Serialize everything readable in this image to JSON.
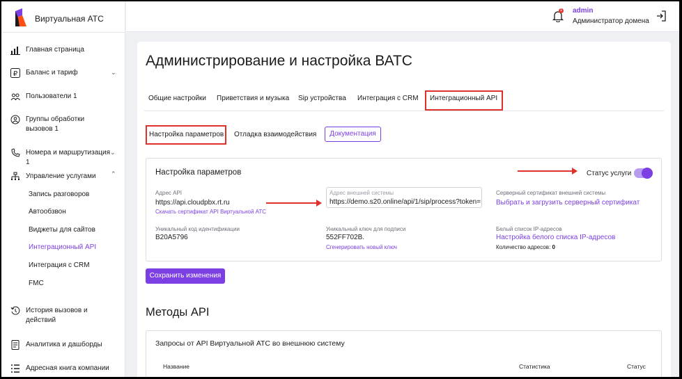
{
  "brand": {
    "name": "Виртуальная АТС"
  },
  "sidebar": {
    "items": [
      {
        "label": "Главная страница",
        "icon": "bar-chart-icon"
      },
      {
        "label": "Баланс и тариф",
        "icon": "ruble-icon"
      },
      {
        "label": "Пользователи 1",
        "icon": "users-icon"
      },
      {
        "label": "Группы обработки вызовов 1",
        "icon": "group-icon"
      },
      {
        "label": "Номера и маршрутизация 1",
        "icon": "phone-routing-icon"
      },
      {
        "label": "Управление услугами",
        "icon": "services-icon"
      },
      {
        "label": "История вызовов и действий",
        "icon": "history-icon"
      },
      {
        "label": "Аналитика и дашборды",
        "icon": "analytics-icon"
      },
      {
        "label": "Адресная книга компании",
        "icon": "address-book-icon"
      }
    ],
    "sub_items": [
      {
        "label": "Запись разговоров"
      },
      {
        "label": "Автообзвон"
      },
      {
        "label": "Виджеты для сайтов"
      },
      {
        "label": "Интеграционный API"
      },
      {
        "label": "Интеграция с CRM"
      },
      {
        "label": "FMC"
      }
    ]
  },
  "header": {
    "user_name": "admin",
    "user_role": "Администратор домена",
    "notification_count": "1"
  },
  "page": {
    "title": "Администрирование и настройка ВАТС",
    "tabs": [
      {
        "label": "Общие настройки"
      },
      {
        "label": "Приветствия и музыка"
      },
      {
        "label": "Sip устройства"
      },
      {
        "label": "Интеграция с CRM"
      },
      {
        "label": "Интеграционный API"
      }
    ],
    "subtabs": [
      {
        "label": "Настройка параметров"
      },
      {
        "label": "Отладка взаимодействия"
      }
    ],
    "doc_button": "Документация"
  },
  "settings": {
    "title": "Настройка параметров",
    "status_label": "Статус услуги",
    "status_on": true,
    "api_address_label": "Адрес API",
    "api_address": "https://api.cloudpbx.rt.ru",
    "download_cert_link": "Скачать сертификат API Виртуальной АТС",
    "ext_address_label": "Адрес внешней системы",
    "ext_address": "https://demo.s20.online/api/1/sip/process?token=",
    "server_cert_label": "Серверный сертификат внешней системы",
    "server_cert_link": "Выбрать и загрузить серверный сертификат",
    "unique_code_label": "Уникальный код идентификации",
    "unique_code": "B20A5796",
    "sign_key_label": "Уникальный ключ для подписи",
    "sign_key": "552FF702B.",
    "generate_key_link": "Сгенерировать новый ключ",
    "whitelist_label": "Белый список IP-адресов",
    "whitelist_link": "Настройка белого списка IP-адресов",
    "address_count_label": "Количество адресов:",
    "address_count": "0"
  },
  "save_button": "Сохранить изменения",
  "methods": {
    "title": "Методы API",
    "subtitle": "Запросы от API Виртуальной АТС во внешнюю систему",
    "columns": [
      "Название",
      "Статистика",
      "Статус"
    ]
  },
  "colors": {
    "accent": "#7b3fe4",
    "highlight": "#e0302b"
  }
}
